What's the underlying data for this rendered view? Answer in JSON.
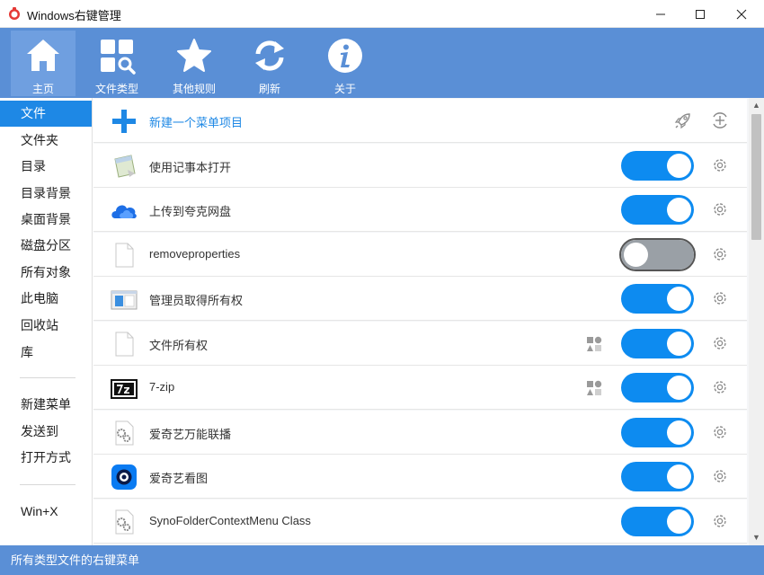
{
  "window": {
    "title": "Windows右键管理",
    "controls": [
      "minimize-icon",
      "maximize-icon",
      "close-icon"
    ]
  },
  "toolbar": {
    "items": [
      {
        "label": "主页",
        "icon": "home-icon",
        "active": true
      },
      {
        "label": "文件类型",
        "icon": "grid-search-icon",
        "active": false
      },
      {
        "label": "其他规则",
        "icon": "star-icon",
        "active": false
      },
      {
        "label": "刷新",
        "icon": "refresh-icon",
        "active": false
      },
      {
        "label": "关于",
        "icon": "info-icon",
        "active": false
      }
    ]
  },
  "sidebar": {
    "items": [
      {
        "label": "文件",
        "active": true
      },
      {
        "label": "文件夹"
      },
      {
        "label": "目录"
      },
      {
        "label": "目录背景"
      },
      {
        "label": "桌面背景"
      },
      {
        "label": "磁盘分区"
      },
      {
        "label": "所有对象"
      },
      {
        "label": "此电脑"
      },
      {
        "label": "回收站"
      },
      {
        "label": "库"
      },
      {
        "label": "新建菜单"
      },
      {
        "label": "发送到"
      },
      {
        "label": "打开方式"
      },
      {
        "label": "Win+X"
      }
    ]
  },
  "list": {
    "new_item": {
      "label": "新建一个菜单项目",
      "icons": [
        "rocket-icon",
        "add-circle-icon"
      ]
    },
    "rows": [
      {
        "label": "使用记事本打开",
        "icon": "notepad-icon",
        "enabled": true
      },
      {
        "label": "上传到夸克网盘",
        "icon": "cloud-icon",
        "enabled": true
      },
      {
        "label": "removeproperties",
        "icon": "blank-file-icon",
        "enabled": false
      },
      {
        "label": "管理员取得所有权",
        "icon": "window-app-icon",
        "enabled": true
      },
      {
        "label": "文件所有权",
        "icon": "blank-file-icon",
        "enabled": true,
        "shapes": true
      },
      {
        "label": "7-zip",
        "icon": "7zip-icon",
        "enabled": true,
        "shapes": true
      },
      {
        "label": "爱奇艺万能联播",
        "icon": "settings-file-icon",
        "enabled": true
      },
      {
        "label": "爱奇艺看图",
        "icon": "iqiyi-viewer-icon",
        "enabled": true
      },
      {
        "label": "SynoFolderContextMenu Class",
        "icon": "settings-file-icon",
        "enabled": true
      }
    ]
  },
  "status": {
    "text": "所有类型文件的右键菜单"
  },
  "colors": {
    "accent": "#5a8fd6",
    "toggle_on": "#0d8bf0",
    "toggle_off": "#9aa0a6",
    "selected": "#1e88e5"
  }
}
